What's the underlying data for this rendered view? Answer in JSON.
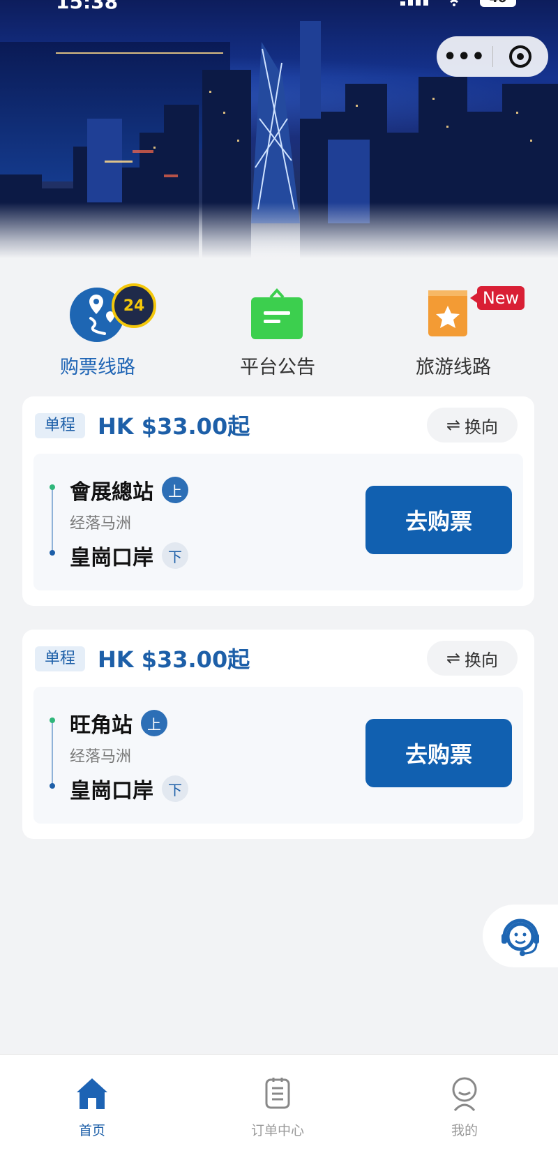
{
  "status_bar": {
    "time": "15:38",
    "battery": "40"
  },
  "capsule": {
    "more_icon": "ellipsis-icon",
    "close_icon": "target-icon"
  },
  "quick_menu": [
    {
      "label": "购票线路",
      "icon": "route-map-icon",
      "badge": "24",
      "active": true
    },
    {
      "label": "平台公告",
      "icon": "notice-bag-icon"
    },
    {
      "label": "旅游线路",
      "icon": "tour-book-icon",
      "tag": "New"
    }
  ],
  "routes": [
    {
      "type": "单程",
      "price": "HK $33.00起",
      "swap_label": "换向",
      "from": "會展總站",
      "from_tag": "上",
      "via": "经落马洲",
      "to": "皇崗口岸",
      "to_tag": "下",
      "buy_label": "去购票"
    },
    {
      "type": "单程",
      "price": "HK $33.00起",
      "swap_label": "换向",
      "from": "旺角站",
      "from_tag": "上",
      "via": "经落马洲",
      "to": "皇崗口岸",
      "to_tag": "下",
      "buy_label": "去购票"
    }
  ],
  "tabbar": [
    {
      "label": "首页",
      "icon": "home-icon",
      "active": true
    },
    {
      "label": "订单中心",
      "icon": "order-list-icon"
    },
    {
      "label": "我的",
      "icon": "profile-icon"
    }
  ],
  "colors": {
    "primary": "#1160b0",
    "accent_new": "#d91f35",
    "notice_green": "#3ccf4e",
    "tour_orange": "#f39b34"
  }
}
